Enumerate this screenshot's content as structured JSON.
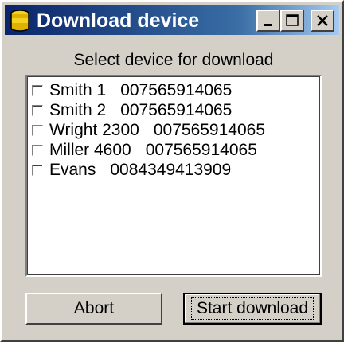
{
  "window": {
    "title": "Download device",
    "icon": "database-icon",
    "controls": [
      "minimize",
      "maximize",
      "close"
    ]
  },
  "heading": "Select device for download",
  "devices": [
    {
      "name": "Smith 1",
      "id": "007565914065",
      "checked": false
    },
    {
      "name": "Smith 2",
      "id": "007565914065",
      "checked": false
    },
    {
      "name": "Wright 2300",
      "id": "007565914065",
      "checked": false
    },
    {
      "name": "Miller 4600",
      "id": "007565914065",
      "checked": false
    },
    {
      "name": "Evans",
      "id": "0084349413909",
      "checked": false
    }
  ],
  "buttons": {
    "abort": "Abort",
    "start": "Start download"
  },
  "colors": {
    "titlebar_start": "#0a246a",
    "titlebar_end": "#a6caf0",
    "face": "#d4d0c8"
  }
}
